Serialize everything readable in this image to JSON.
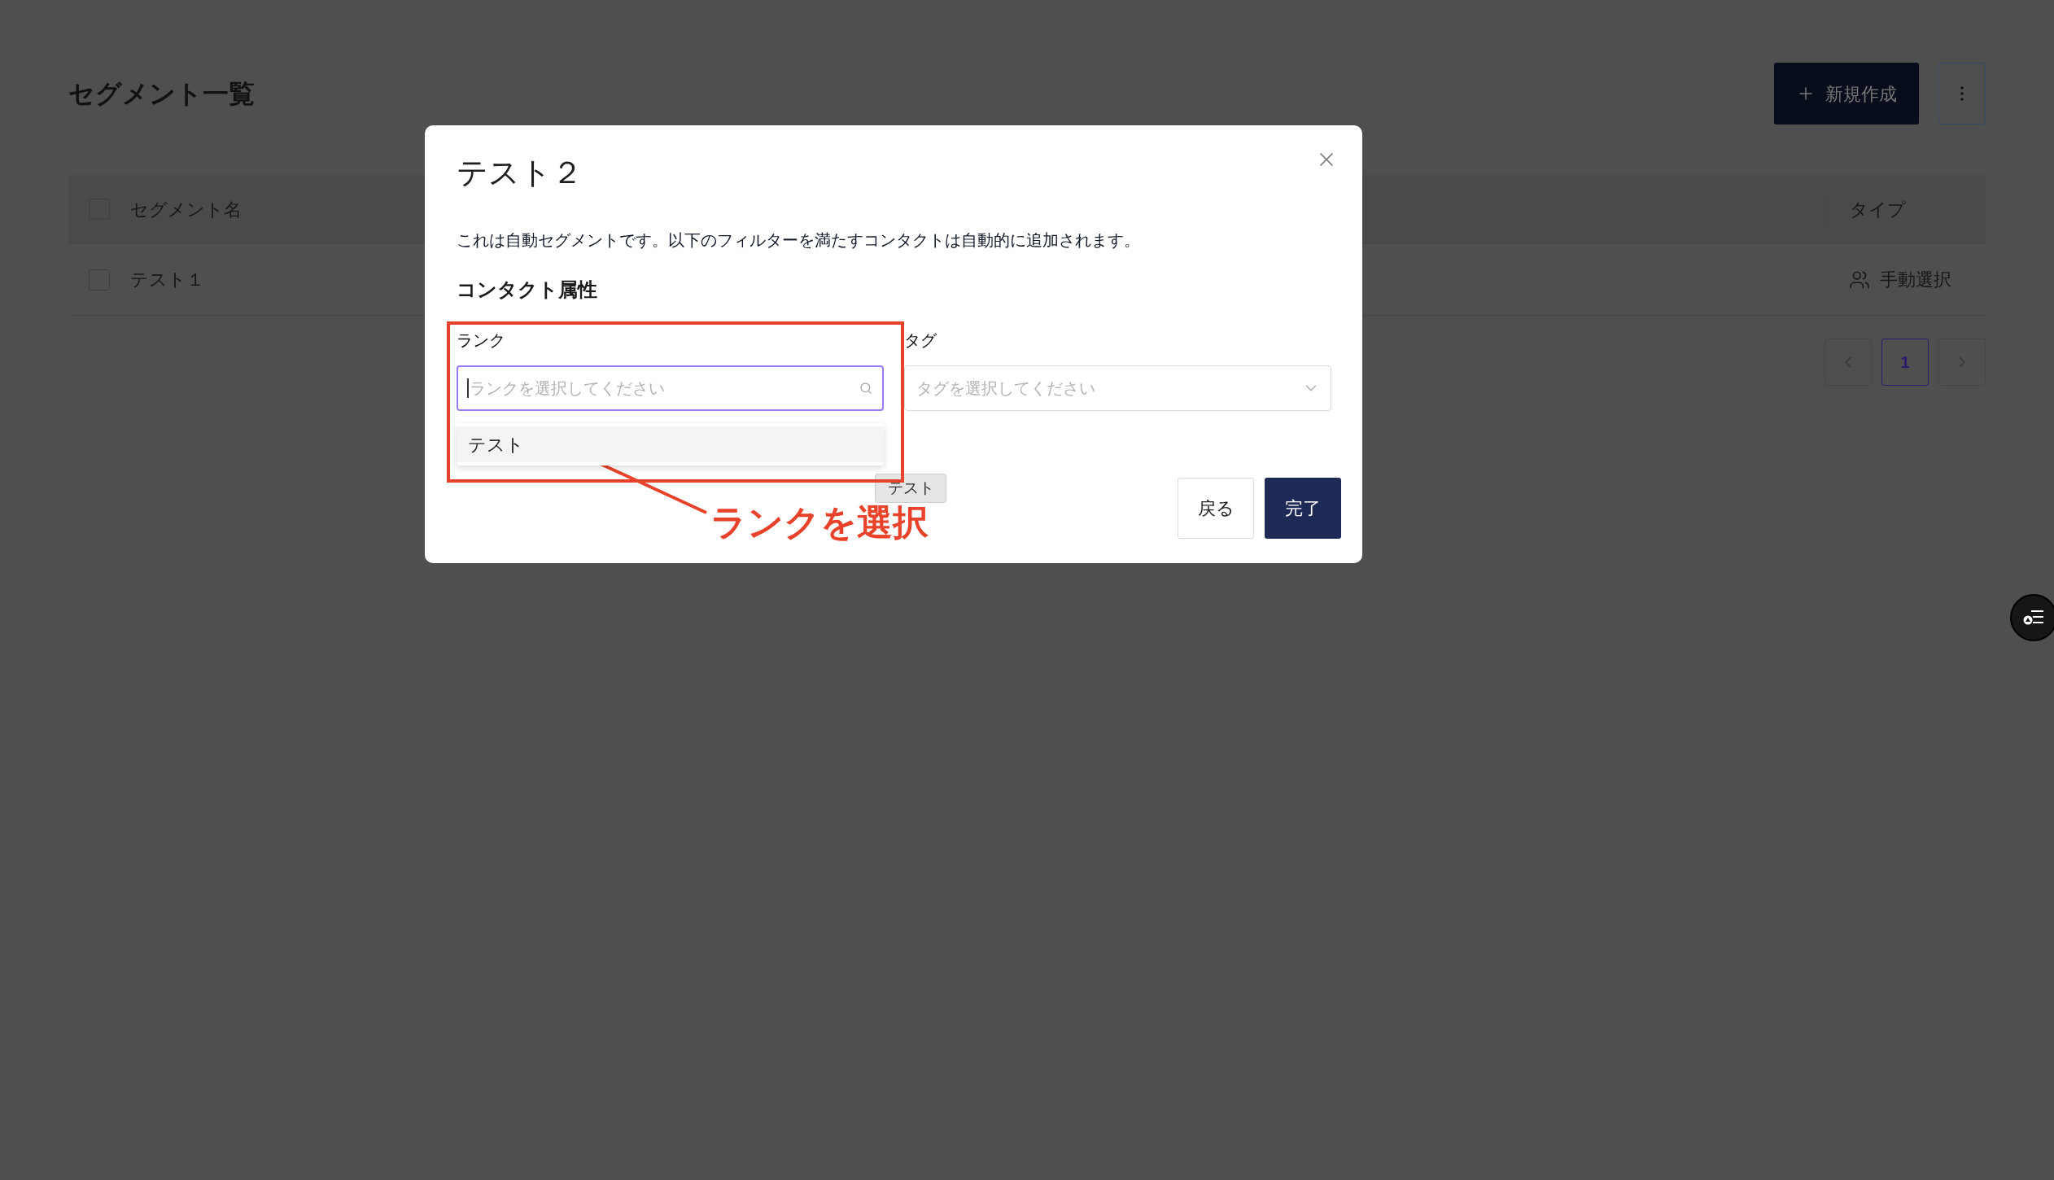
{
  "page": {
    "title": "セグメント一覧",
    "new_button": "新規作成"
  },
  "table": {
    "header_checked": false,
    "columns": [
      "セグメント名",
      "タイプ"
    ],
    "rows": [
      {
        "name": "テスト１",
        "type": "手動選択",
        "checked": false
      }
    ]
  },
  "pagination": {
    "pages": [
      {
        "label": "1",
        "selected": true
      }
    ]
  },
  "dialog": {
    "title": "テスト２",
    "description": "これは自動セグメントです。以下のフィルターを満たすコンタクトは自動的に追加されます。",
    "section": "コンタクト属性",
    "fields": [
      {
        "label": "ランク",
        "placeholder": "ランクを選択してください",
        "kind": "search",
        "focused": true,
        "options": [
          {
            "label": "テスト",
            "highlighted": true
          }
        ]
      },
      {
        "label": "タグ",
        "placeholder": "タグを選択してください",
        "kind": "select",
        "focused": false
      }
    ],
    "tooltip": "テスト",
    "buttons": [
      {
        "label": "戻る",
        "primary": false
      },
      {
        "label": "完了",
        "primary": true
      }
    ]
  },
  "annotation": {
    "text": "ランクを選択"
  }
}
